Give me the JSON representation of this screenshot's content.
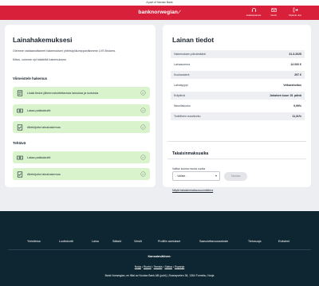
{
  "topbar": {
    "text": "A part of Nordax Bank"
  },
  "header": {
    "logo_text": "banknorwegian",
    "nav": [
      {
        "label": "Asiakaspalvelu",
        "icon": "headset-icon"
      },
      {
        "label": "Viestit",
        "icon": "mail-icon"
      },
      {
        "label": "Kirjaudu ulos",
        "icon": "logout-icon"
      }
    ]
  },
  "left": {
    "title": "Lainahakemuksesi",
    "intro": "Olemme vastaanottaneet hakemuksen yhteistyökumppaniltamme LVS Brokers.",
    "thanks": "Kiitos, voimme nyt käsitellä hakemuksesi",
    "prepare_title": "Viimeistele hakemus",
    "prepare_tasks": [
      {
        "label": "Lisää tiedot jälleenrahoitettavista lainoista ja luotoista",
        "icon": "document-list-icon"
      },
      {
        "label": "Lataa palkkakuitti",
        "icon": "money-icon"
      },
      {
        "label": "Allekirjoita lainahakemus",
        "icon": "sign-icon"
      }
    ],
    "done_title": "Tehtävä",
    "done_tasks": [
      {
        "label": "Lataa palkkakuitti",
        "icon": "money-icon"
      },
      {
        "label": "Allekirjoita lainahakemus",
        "icon": "sign-icon"
      }
    ]
  },
  "right": {
    "title": "Lainan tiedot",
    "rows": [
      {
        "key": "Hakemuksen päivämäärä",
        "value": "31.3.2025"
      },
      {
        "key": "Lainasumma",
        "value": "14 000 €"
      },
      {
        "key": "Kuukausierä",
        "value": "297 €"
      },
      {
        "key": "Lainatyyppi",
        "value": "Velkarahoitus"
      },
      {
        "key": "Eräpäivä",
        "value": "Jokaisen kuun 15. päivä"
      },
      {
        "key": "Nimelliskorko",
        "value": "9,99%"
      },
      {
        "key": "Todellinen vuosikorko",
        "value": "11,31%"
      }
    ],
    "repayment_title": "Takaisinmaksuaika",
    "select_label": "Valitse kuinka monta vuotta",
    "select_value": "- Valitse -",
    "select_button": "Tarkista",
    "schedule_link": "Näytä takaisinmaksusuunnitelma"
  },
  "footer": {
    "nav": [
      "Yleistietoa",
      "Luottokortti",
      "Laina",
      "Säästö",
      "Viestit",
      "Profiilin asetukset",
      "Saavutettavuusseloste",
      "Tietosuoja",
      "Evästeet"
    ],
    "lang_heading": "Kansainvälinen:",
    "langs": [
      "Norja",
      "Ruotsi",
      "Tanska",
      "Saksa",
      "Espanja"
    ],
    "address": "Bank Norwegian, en filial av Nordax Bank AB (publ) | Snarøyveien 36, 1364 Fornebu, Norja"
  },
  "colors": {
    "brand_red": "#d8203a",
    "task_green": "#d9f4cc",
    "footer_navy": "#0e2631"
  }
}
